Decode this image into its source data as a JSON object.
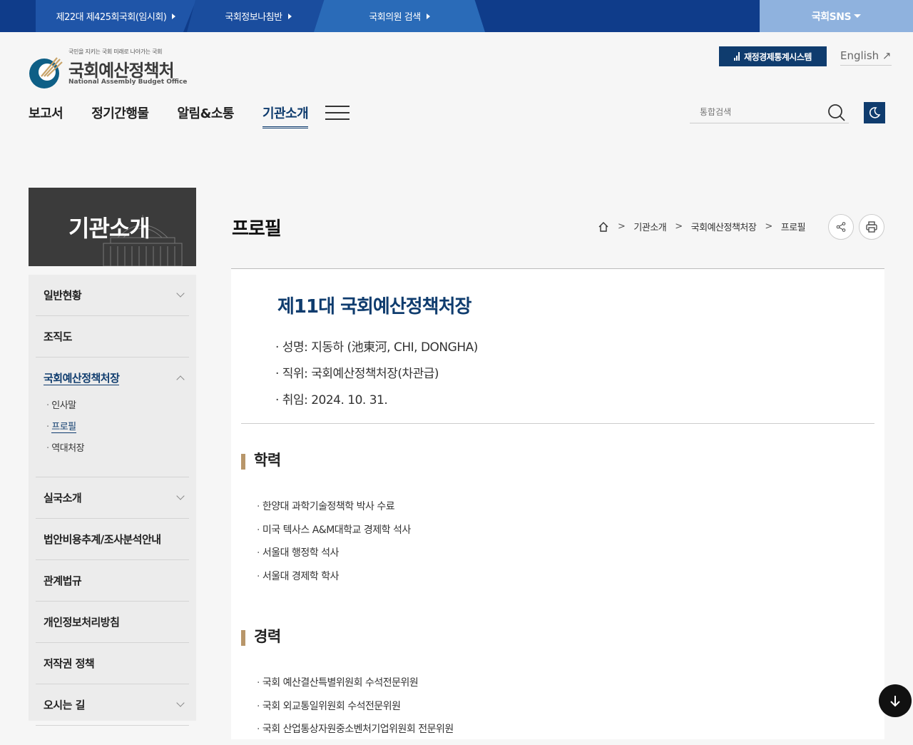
{
  "topbar": {
    "links": [
      "제22대 제425회국회(임시회)",
      "국회정보나침반",
      "국회의원 검색"
    ],
    "sns": "국회SNS"
  },
  "header": {
    "logo_slogan": "국민을 지키는 국회 미래로 나아가는 국회",
    "logo_name": "국회예산정책처",
    "logo_eng": "National Assembly Budget Office",
    "system_button": "재정경제통계시스템",
    "english_link": "English ↗",
    "search_placeholder": "통합검색"
  },
  "gnb": [
    "보고서",
    "정기간행물",
    "알림&소통",
    "기관소개"
  ],
  "sidebar": {
    "title": "기관소개",
    "items": [
      {
        "label": "일반현황"
      },
      {
        "label": "조직도"
      },
      {
        "label": "국회예산정책처장",
        "sub": [
          "인사말",
          "프로필",
          "역대처장"
        ]
      },
      {
        "label": "실국소개"
      },
      {
        "label": "법안비용추계/조사분석안내"
      },
      {
        "label": "관계법규"
      },
      {
        "label": "개인정보처리방침"
      },
      {
        "label": "저작권 정책"
      },
      {
        "label": "오시는 길"
      }
    ]
  },
  "page": {
    "title": "프로필",
    "breadcrumb": [
      "기관소개",
      "국회예산정책처장",
      "프로필"
    ]
  },
  "profile": {
    "heading": "제11대 국회예산정책처장",
    "info": [
      "· 성명:  지동하 (池東河, CHI, DONGHA)",
      "· 직위:  국회예산정책처장(차관급)",
      "· 취임:  2024. 10. 31."
    ],
    "education_title": "학력",
    "education": [
      "한양대 과학기술정책학 박사 수료",
      "미국 텍사스 A&M대학교 경제학 석사",
      "서울대 행정학 석사",
      "서울대 경제학 학사"
    ],
    "career_title": "경력",
    "career": [
      "국회 예산결산특별위원회 수석전문위원",
      "국회 외교통일위원회 수석전문위원",
      "국회 산업통상자원중소벤처기업위원회 전문위원"
    ]
  },
  "colors": {
    "navy": "#0f3c6e",
    "topbar": "#0f3c8a",
    "accent_bar": "#b8966a"
  }
}
